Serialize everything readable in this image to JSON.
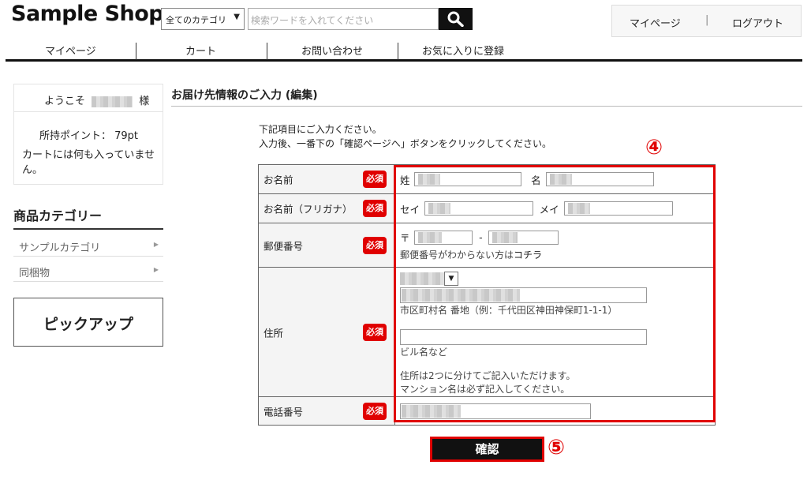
{
  "header": {
    "logo": "Sample Shop",
    "category_select": "全てのカテゴリ",
    "search_placeholder": "検索ワードを入れてください",
    "account": {
      "mypage": "マイページ",
      "separator": "|",
      "logout": "ログアウト"
    }
  },
  "nav": {
    "items": [
      "マイページ",
      "カート",
      "お問い合わせ",
      "お気に入りに登録"
    ]
  },
  "sidebar": {
    "welcome_prefix": "ようこそ",
    "welcome_suffix": "様",
    "points": "所持ポイント： 79pt",
    "cart_status": "カートには何も入っていません。",
    "category_title": "商品カテゴリー",
    "categories": [
      "サンプルカテゴリ",
      "同梱物"
    ],
    "pickup": "ピックアップ"
  },
  "main": {
    "title": "お届け先情報のご入力 (編集)",
    "instructions": [
      "下記項目にご入力ください。",
      "入力後、一番下の「確認ページへ」ボタンをクリックしてください。"
    ],
    "required_badge": "必須",
    "fields": {
      "name": {
        "label": "お名前",
        "sei": "姓",
        "mei": "名"
      },
      "kana": {
        "label": "お名前（フリガナ）",
        "sei": "セイ",
        "mei": "メイ"
      },
      "zip": {
        "label": "郵便番号",
        "mark": "〒",
        "dash": "-",
        "note_prefix": "郵便番号がわからない方は",
        "note_link": "コチラ"
      },
      "address": {
        "label": "住所",
        "hint1": "市区町村名 番地（例：千代田区神田神保町1-1-1）",
        "hint2": "ビル名など",
        "note1": "住所は2つに分けてご記入いただけます。",
        "note2": "マンション名は必ず記入してください。"
      },
      "phone": {
        "label": "電話番号"
      }
    },
    "confirm_button": "確認"
  },
  "annotations": {
    "circle4": "④",
    "circle5": "⑤"
  },
  "colors": {
    "required": "#e00000",
    "highlight": "#e00000",
    "button": "#111111"
  }
}
